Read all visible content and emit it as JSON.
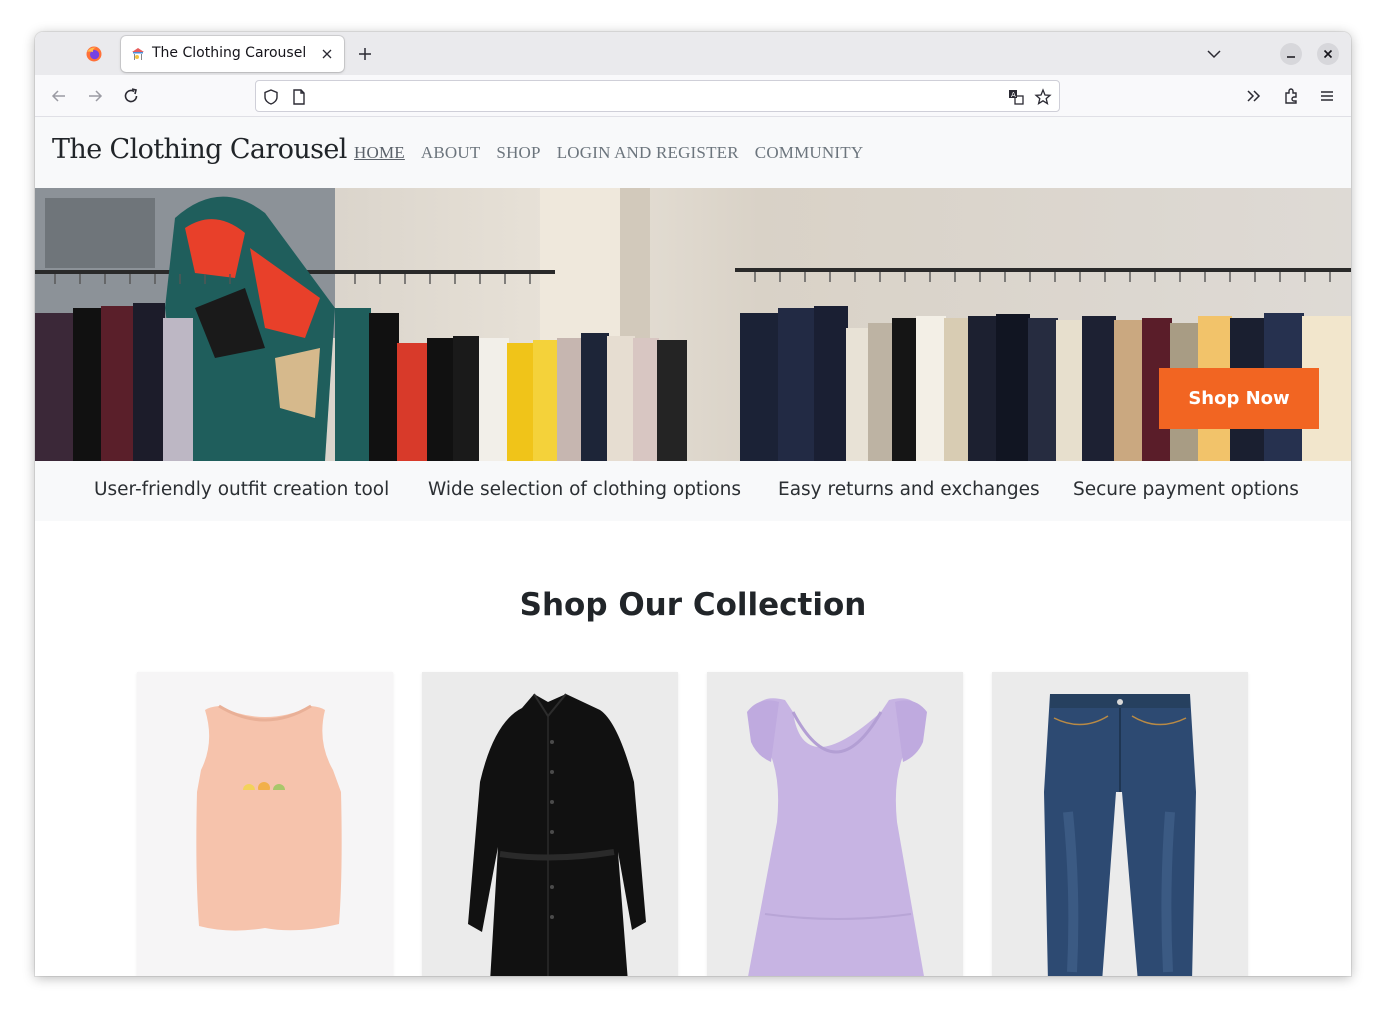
{
  "browser": {
    "tab_title": "The Clothing Carousel",
    "url": ""
  },
  "site": {
    "brand": "The Clothing Carousel",
    "nav": [
      {
        "label": "HOME",
        "active": true
      },
      {
        "label": "ABOUT",
        "active": false
      },
      {
        "label": "SHOP",
        "active": false
      },
      {
        "label": "LOGIN AND REGISTER",
        "active": false
      },
      {
        "label": "COMMUNITY",
        "active": false
      }
    ]
  },
  "hero": {
    "button_label": "Shop Now",
    "button_color": "#f26522"
  },
  "features": [
    "User-friendly outfit creation tool",
    "Wide selection of clothing options",
    "Easy returns and exchanges",
    "Secure payment options"
  ],
  "collection": {
    "title": "Shop Our Collection",
    "products": [
      {
        "name": "peach tank top",
        "color": "#f6c3ac"
      },
      {
        "name": "black shirt dress",
        "color": "#111111"
      },
      {
        "name": "lavender ruffle dress",
        "color": "#c7b4e3"
      },
      {
        "name": "blue jeans",
        "color": "#2d4a72"
      }
    ]
  },
  "icons": [
    "firefox-icon",
    "carousel-favicon",
    "close-icon",
    "plus-icon",
    "chevron-down-icon",
    "minimize-icon",
    "back-icon",
    "forward-icon",
    "reload-icon",
    "shield-icon",
    "page-icon",
    "translate-icon",
    "star-icon",
    "overflow-icon",
    "extensions-icon",
    "menu-icon"
  ]
}
